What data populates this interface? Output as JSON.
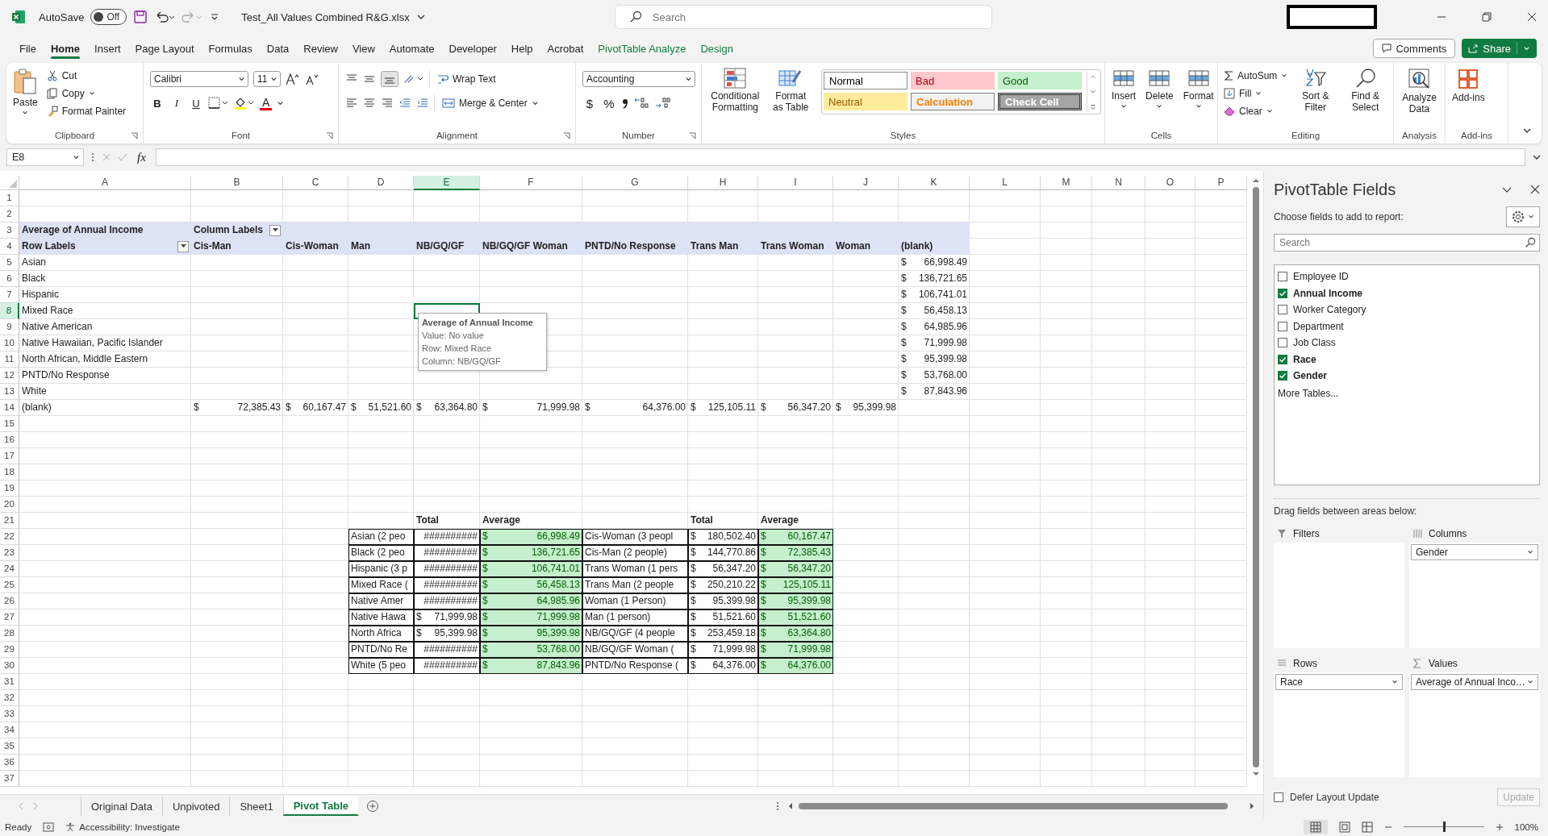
{
  "title_bar": {
    "autosave": {
      "label": "AutoSave",
      "on": false,
      "state": "Off"
    },
    "file_name": "Test_All Values Combined R&G.xlsx",
    "search": {
      "placeholder": "Search"
    }
  },
  "menu_tabs": [
    {
      "label": "File",
      "selected": false,
      "contextual": false
    },
    {
      "label": "Home",
      "selected": true,
      "contextual": false
    },
    {
      "label": "Insert",
      "selected": false,
      "contextual": false
    },
    {
      "label": "Page Layout",
      "selected": false,
      "contextual": false
    },
    {
      "label": "Formulas",
      "selected": false,
      "contextual": false
    },
    {
      "label": "Data",
      "selected": false,
      "contextual": false
    },
    {
      "label": "Review",
      "selected": false,
      "contextual": false
    },
    {
      "label": "View",
      "selected": false,
      "contextual": false
    },
    {
      "label": "Automate",
      "selected": false,
      "contextual": false
    },
    {
      "label": "Developer",
      "selected": false,
      "contextual": false
    },
    {
      "label": "Help",
      "selected": false,
      "contextual": false
    },
    {
      "label": "Acrobat",
      "selected": false,
      "contextual": false
    },
    {
      "label": "PivotTable Analyze",
      "selected": false,
      "contextual": true
    },
    {
      "label": "Design",
      "selected": false,
      "contextual": true
    }
  ],
  "account_buttons": {
    "comments": "Comments",
    "share": "Share"
  },
  "ribbon": {
    "clipboard": {
      "paste": "Paste",
      "cut": "Cut",
      "copy": "Copy",
      "format_painter": "Format Painter",
      "label": "Clipboard"
    },
    "font": {
      "name": "Calibri",
      "size": "11",
      "styles": [
        "B",
        "I",
        "U"
      ],
      "color_glyph": "A",
      "label": "Font"
    },
    "alignment": {
      "wrap": "Wrap Text",
      "merge": "Merge & Center",
      "label": "Alignment"
    },
    "number": {
      "format": "Accounting",
      "symbols": [
        "$",
        "%"
      ],
      "label": "Number"
    },
    "styles": {
      "conditional": "Conditional Formatting",
      "format_table": "Format as Table",
      "cells": [
        {
          "label": "Normal",
          "kind": "normal"
        },
        {
          "label": "Bad",
          "kind": "bad"
        },
        {
          "label": "Good",
          "kind": "good"
        },
        {
          "label": "Neutral",
          "kind": "neutral"
        },
        {
          "label": "Calculation",
          "kind": "calculation"
        },
        {
          "label": "Check Cell",
          "kind": "check"
        }
      ],
      "label": "Styles"
    },
    "cells": {
      "buttons": [
        "Insert",
        "Delete",
        "Format"
      ],
      "label": "Cells"
    },
    "editing": {
      "autosum": "AutoSum",
      "fill": "Fill",
      "clear": "Clear",
      "sort": "Sort & Filter",
      "find": "Find & Select",
      "label": "Editing"
    },
    "analysis": {
      "button": "Analyze Data",
      "label": "Analysis"
    },
    "addins": {
      "button": "Add-ins",
      "label": "Add-ins"
    }
  },
  "formula_bar": {
    "name_box": "E8",
    "fx": "fx"
  },
  "sheet": {
    "columns": [
      {
        "letter": "A",
        "selected": false
      },
      {
        "letter": "B",
        "selected": false
      },
      {
        "letter": "C",
        "selected": false
      },
      {
        "letter": "D",
        "selected": false
      },
      {
        "letter": "E",
        "selected": true
      },
      {
        "letter": "F",
        "selected": false
      },
      {
        "letter": "G",
        "selected": false
      },
      {
        "letter": "H",
        "selected": false
      },
      {
        "letter": "I",
        "selected": false
      },
      {
        "letter": "J",
        "selected": false
      },
      {
        "letter": "K",
        "selected": false
      },
      {
        "letter": "L",
        "selected": false
      },
      {
        "letter": "M",
        "selected": false
      },
      {
        "letter": "N",
        "selected": false
      },
      {
        "letter": "O",
        "selected": false
      },
      {
        "letter": "P",
        "selected": false
      }
    ],
    "rows": [
      {
        "number": "1",
        "selected": false,
        "kind": "plain"
      },
      {
        "number": "2",
        "selected": false,
        "kind": "plain"
      },
      {
        "number": "3",
        "selected": false,
        "kind": "pivot_header",
        "cells": [
          {
            "kind": "pivot_bold",
            "text": "Average of Annual Income"
          },
          {
            "kind": "pivot_filter",
            "text": "Column Labels"
          }
        ]
      },
      {
        "number": "4",
        "selected": false,
        "kind": "pivot_header",
        "cells": [
          {
            "kind": "pivot_filter",
            "text": "Row Labels"
          },
          {
            "kind": "pivot_bold",
            "text": "Cis-Man"
          },
          {
            "kind": "pivot_bold",
            "text": "Cis-Woman"
          },
          {
            "kind": "pivot_bold",
            "text": "Man"
          },
          {
            "kind": "pivot_bold",
            "text": "NB/GQ/GF"
          },
          {
            "kind": "pivot_bold",
            "text": "NB/GQ/GF Woman"
          },
          {
            "kind": "pivot_bold",
            "text": "PNTD/No Response"
          },
          {
            "kind": "pivot_bold",
            "text": "Trans Man"
          },
          {
            "kind": "pivot_bold",
            "text": "Trans Woman"
          },
          {
            "kind": "pivot_bold",
            "text": "Woman"
          },
          {
            "kind": "pivot_bold",
            "text": "(blank)"
          }
        ]
      },
      {
        "number": "5",
        "selected": false,
        "kind": "plain",
        "cells": [
          {
            "kind": "text",
            "text": "Asian"
          },
          {
            "kind": "empty"
          },
          {
            "kind": "empty"
          },
          {
            "kind": "empty"
          },
          {
            "kind": "empty"
          },
          {
            "kind": "empty"
          },
          {
            "kind": "empty"
          },
          {
            "kind": "empty"
          },
          {
            "kind": "empty"
          },
          {
            "kind": "empty"
          },
          {
            "kind": "money",
            "currency": "$",
            "amount": "66,998.49"
          }
        ]
      },
      {
        "number": "6",
        "selected": false,
        "kind": "plain",
        "cells": [
          {
            "kind": "text",
            "text": "Black"
          },
          {
            "kind": "empty"
          },
          {
            "kind": "empty"
          },
          {
            "kind": "empty"
          },
          {
            "kind": "empty"
          },
          {
            "kind": "empty"
          },
          {
            "kind": "empty"
          },
          {
            "kind": "empty"
          },
          {
            "kind": "empty"
          },
          {
            "kind": "empty"
          },
          {
            "kind": "money",
            "currency": "$",
            "amount": "136,721.65"
          }
        ]
      },
      {
        "number": "7",
        "selected": false,
        "kind": "plain",
        "cells": [
          {
            "kind": "text",
            "text": "Hispanic"
          },
          {
            "kind": "empty"
          },
          {
            "kind": "empty"
          },
          {
            "kind": "empty"
          },
          {
            "kind": "empty"
          },
          {
            "kind": "empty"
          },
          {
            "kind": "empty"
          },
          {
            "kind": "empty"
          },
          {
            "kind": "empty"
          },
          {
            "kind": "empty"
          },
          {
            "kind": "money",
            "currency": "$",
            "amount": "106,741.01"
          }
        ]
      },
      {
        "number": "8",
        "selected": true,
        "kind": "plain",
        "cells": [
          {
            "kind": "text",
            "text": "Mixed Race"
          },
          {
            "kind": "empty"
          },
          {
            "kind": "empty"
          },
          {
            "kind": "empty"
          },
          {
            "kind": "empty"
          },
          {
            "kind": "empty"
          },
          {
            "kind": "empty"
          },
          {
            "kind": "empty"
          },
          {
            "kind": "empty"
          },
          {
            "kind": "empty"
          },
          {
            "kind": "money",
            "currency": "$",
            "amount": "56,458.13"
          }
        ]
      },
      {
        "number": "9",
        "selected": false,
        "kind": "plain",
        "cells": [
          {
            "kind": "text",
            "text": "Native American"
          },
          {
            "kind": "empty"
          },
          {
            "kind": "empty"
          },
          {
            "kind": "empty"
          },
          {
            "kind": "empty"
          },
          {
            "kind": "empty"
          },
          {
            "kind": "empty"
          },
          {
            "kind": "empty"
          },
          {
            "kind": "empty"
          },
          {
            "kind": "empty"
          },
          {
            "kind": "money",
            "currency": "$",
            "amount": "64,985.96"
          }
        ]
      },
      {
        "number": "10",
        "selected": false,
        "kind": "plain",
        "cells": [
          {
            "kind": "text",
            "text": "Native Hawaiian, Pacific Islander"
          },
          {
            "kind": "empty"
          },
          {
            "kind": "empty"
          },
          {
            "kind": "empty"
          },
          {
            "kind": "empty"
          },
          {
            "kind": "empty"
          },
          {
            "kind": "empty"
          },
          {
            "kind": "empty"
          },
          {
            "kind": "empty"
          },
          {
            "kind": "empty"
          },
          {
            "kind": "money",
            "currency": "$",
            "amount": "71,999.98"
          }
        ]
      },
      {
        "number": "11",
        "selected": false,
        "kind": "plain",
        "cells": [
          {
            "kind": "text",
            "text": "North African, Middle Eastern"
          },
          {
            "kind": "empty"
          },
          {
            "kind": "empty"
          },
          {
            "kind": "empty"
          },
          {
            "kind": "empty"
          },
          {
            "kind": "empty"
          },
          {
            "kind": "empty"
          },
          {
            "kind": "empty"
          },
          {
            "kind": "empty"
          },
          {
            "kind": "empty"
          },
          {
            "kind": "money",
            "currency": "$",
            "amount": "95,399.98"
          }
        ]
      },
      {
        "number": "12",
        "selected": false,
        "kind": "plain",
        "cells": [
          {
            "kind": "text",
            "text": "PNTD/No Response"
          },
          {
            "kind": "empty"
          },
          {
            "kind": "empty"
          },
          {
            "kind": "empty"
          },
          {
            "kind": "empty"
          },
          {
            "kind": "empty"
          },
          {
            "kind": "empty"
          },
          {
            "kind": "empty"
          },
          {
            "kind": "empty"
          },
          {
            "kind": "empty"
          },
          {
            "kind": "money",
            "currency": "$",
            "amount": "53,768.00"
          }
        ]
      },
      {
        "number": "13",
        "selected": false,
        "kind": "plain",
        "cells": [
          {
            "kind": "text",
            "text": "White"
          },
          {
            "kind": "empty"
          },
          {
            "kind": "empty"
          },
          {
            "kind": "empty"
          },
          {
            "kind": "empty"
          },
          {
            "kind": "empty"
          },
          {
            "kind": "empty"
          },
          {
            "kind": "empty"
          },
          {
            "kind": "empty"
          },
          {
            "kind": "empty"
          },
          {
            "kind": "money",
            "currency": "$",
            "amount": "87,843.96"
          }
        ]
      },
      {
        "number": "14",
        "selected": false,
        "kind": "plain",
        "cells": [
          {
            "kind": "text",
            "text": "(blank)"
          },
          {
            "kind": "money",
            "currency": "$",
            "amount": "72,385.43"
          },
          {
            "kind": "money",
            "currency": "$",
            "amount": "60,167.47"
          },
          {
            "kind": "money",
            "currency": "$",
            "amount": "51,521.60"
          },
          {
            "kind": "money",
            "currency": "$",
            "amount": "63,364.80"
          },
          {
            "kind": "money",
            "currency": "$",
            "amount": "71,999.98"
          },
          {
            "kind": "money",
            "currency": "$",
            "amount": "64,376.00"
          },
          {
            "kind": "money",
            "currency": "$",
            "amount": "125,105.11"
          },
          {
            "kind": "money",
            "currency": "$",
            "amount": "56,347.20"
          },
          {
            "kind": "money",
            "currency": "$",
            "amount": "95,399.98"
          }
        ]
      },
      {
        "number": "15",
        "selected": false,
        "kind": "plain"
      },
      {
        "number": "16",
        "selected": false,
        "kind": "plain"
      },
      {
        "number": "17",
        "selected": false,
        "kind": "plain"
      },
      {
        "number": "18",
        "selected": false,
        "kind": "plain"
      },
      {
        "number": "19",
        "selected": false,
        "kind": "plain"
      },
      {
        "number": "20",
        "selected": false,
        "kind": "plain"
      },
      {
        "number": "21",
        "selected": false,
        "kind": "plain",
        "cells": [
          {
            "kind": "empty"
          },
          {
            "kind": "empty"
          },
          {
            "kind": "empty"
          },
          {
            "kind": "empty"
          },
          {
            "kind": "bold",
            "text": "Total"
          },
          {
            "kind": "bold",
            "text": "Average"
          },
          {
            "kind": "empty"
          },
          {
            "kind": "bold",
            "text": "Total"
          },
          {
            "kind": "bold",
            "text": "Average"
          }
        ]
      },
      {
        "number": "22",
        "selected": false,
        "kind": "plain",
        "cells": [
          {
            "kind": "empty"
          },
          {
            "kind": "empty"
          },
          {
            "kind": "empty"
          },
          {
            "kind": "boxed_text",
            "text": "Asian (2 peo"
          },
          {
            "kind": "boxed_hash",
            "text": "##########"
          },
          {
            "kind": "good_money",
            "currency": "$",
            "amount": "66,998.49"
          },
          {
            "kind": "boxed_text",
            "text": "Cis-Woman (3 peopl"
          },
          {
            "kind": "boxed_money",
            "currency": "$",
            "amount": "180,502.40"
          },
          {
            "kind": "good_money",
            "currency": "$",
            "amount": "60,167.47"
          }
        ]
      },
      {
        "number": "23",
        "selected": false,
        "kind": "plain",
        "cells": [
          {
            "kind": "empty"
          },
          {
            "kind": "empty"
          },
          {
            "kind": "empty"
          },
          {
            "kind": "boxed_text",
            "text": "Black (2 peo"
          },
          {
            "kind": "boxed_hash",
            "text": "##########"
          },
          {
            "kind": "good_money",
            "currency": "$",
            "amount": "136,721.65"
          },
          {
            "kind": "boxed_text",
            "text": "Cis-Man (2 people)"
          },
          {
            "kind": "boxed_money",
            "currency": "$",
            "amount": "144,770.86"
          },
          {
            "kind": "good_money",
            "currency": "$",
            "amount": "72,385.43"
          }
        ]
      },
      {
        "number": "24",
        "selected": false,
        "kind": "plain",
        "cells": [
          {
            "kind": "empty"
          },
          {
            "kind": "empty"
          },
          {
            "kind": "empty"
          },
          {
            "kind": "boxed_text",
            "text": "Hispanic (3 p"
          },
          {
            "kind": "boxed_hash",
            "text": "##########"
          },
          {
            "kind": "good_money",
            "currency": "$",
            "amount": "106,741.01"
          },
          {
            "kind": "boxed_text",
            "text": "Trans Woman (1 pers"
          },
          {
            "kind": "boxed_money",
            "currency": "$",
            "amount": "56,347.20"
          },
          {
            "kind": "good_money",
            "currency": "$",
            "amount": "56,347.20"
          }
        ]
      },
      {
        "number": "25",
        "selected": false,
        "kind": "plain",
        "cells": [
          {
            "kind": "empty"
          },
          {
            "kind": "empty"
          },
          {
            "kind": "empty"
          },
          {
            "kind": "boxed_text",
            "text": "Mixed Race ("
          },
          {
            "kind": "boxed_hash",
            "text": "##########"
          },
          {
            "kind": "good_money",
            "currency": "$",
            "amount": "56,458.13"
          },
          {
            "kind": "boxed_text",
            "text": "Trans Man (2 people"
          },
          {
            "kind": "boxed_money",
            "currency": "$",
            "amount": "250,210.22"
          },
          {
            "kind": "good_money",
            "currency": "$",
            "amount": "125,105.11"
          }
        ]
      },
      {
        "number": "26",
        "selected": false,
        "kind": "plain",
        "cells": [
          {
            "kind": "empty"
          },
          {
            "kind": "empty"
          },
          {
            "kind": "empty"
          },
          {
            "kind": "boxed_text",
            "text": "Native Amer"
          },
          {
            "kind": "boxed_hash",
            "text": "##########"
          },
          {
            "kind": "good_money",
            "currency": "$",
            "amount": "64,985.96"
          },
          {
            "kind": "boxed_text",
            "text": "Woman (1 Person)"
          },
          {
            "kind": "boxed_money",
            "currency": "$",
            "amount": "95,399.98"
          },
          {
            "kind": "good_money",
            "currency": "$",
            "amount": "95,399.98"
          }
        ]
      },
      {
        "number": "27",
        "selected": false,
        "kind": "plain",
        "cells": [
          {
            "kind": "empty"
          },
          {
            "kind": "empty"
          },
          {
            "kind": "empty"
          },
          {
            "kind": "boxed_text",
            "text": "Native Hawa"
          },
          {
            "kind": "boxed_money",
            "currency": "$",
            "amount": "71,999.98"
          },
          {
            "kind": "good_money",
            "currency": "$",
            "amount": "71,999.98"
          },
          {
            "kind": "boxed_text",
            "text": "Man (1 person)"
          },
          {
            "kind": "boxed_money",
            "currency": "$",
            "amount": "51,521.60"
          },
          {
            "kind": "good_money",
            "currency": "$",
            "amount": "51,521.60"
          }
        ]
      },
      {
        "number": "28",
        "selected": false,
        "kind": "plain",
        "cells": [
          {
            "kind": "empty"
          },
          {
            "kind": "empty"
          },
          {
            "kind": "empty"
          },
          {
            "kind": "boxed_text",
            "text": "North Africa"
          },
          {
            "kind": "boxed_money",
            "currency": "$",
            "amount": "95,399.98"
          },
          {
            "kind": "good_money",
            "currency": "$",
            "amount": "95,399.98"
          },
          {
            "kind": "boxed_text",
            "text": "NB/GQ/GF (4 people"
          },
          {
            "kind": "boxed_money",
            "currency": "$",
            "amount": "253,459.18"
          },
          {
            "kind": "good_money",
            "currency": "$",
            "amount": "63,364.80"
          }
        ]
      },
      {
        "number": "29",
        "selected": false,
        "kind": "plain",
        "cells": [
          {
            "kind": "empty"
          },
          {
            "kind": "empty"
          },
          {
            "kind": "empty"
          },
          {
            "kind": "boxed_text",
            "text": "PNTD/No Re"
          },
          {
            "kind": "boxed_hash",
            "text": "##########"
          },
          {
            "kind": "good_money",
            "currency": "$",
            "amount": "53,768.00"
          },
          {
            "kind": "boxed_text",
            "text": "NB/GQ/GF Woman ("
          },
          {
            "kind": "boxed_money",
            "currency": "$",
            "amount": "71,999.98"
          },
          {
            "kind": "good_money",
            "currency": "$",
            "amount": "71,999.98"
          }
        ]
      },
      {
        "number": "30",
        "selected": false,
        "kind": "plain",
        "cells": [
          {
            "kind": "empty"
          },
          {
            "kind": "empty"
          },
          {
            "kind": "empty"
          },
          {
            "kind": "boxed_text",
            "text": "White (5 peo"
          },
          {
            "kind": "boxed_hash",
            "text": "##########"
          },
          {
            "kind": "good_money",
            "currency": "$",
            "amount": "87,843.96"
          },
          {
            "kind": "boxed_text",
            "text": "PNTD/No Response ("
          },
          {
            "kind": "boxed_money",
            "currency": "$",
            "amount": "64,376.00"
          },
          {
            "kind": "good_money",
            "currency": "$",
            "amount": "64,376.00"
          }
        ]
      },
      {
        "number": "31",
        "selected": false,
        "kind": "plain"
      },
      {
        "number": "32",
        "selected": false,
        "kind": "plain"
      },
      {
        "number": "33",
        "selected": false,
        "kind": "plain"
      },
      {
        "number": "34",
        "selected": false,
        "kind": "plain"
      },
      {
        "number": "35",
        "selected": false,
        "kind": "plain"
      },
      {
        "number": "36",
        "selected": false,
        "kind": "plain"
      },
      {
        "number": "37",
        "selected": false,
        "kind": "plain"
      }
    ],
    "tooltip": {
      "title": "Average of Annual Income",
      "lines": [
        "Value: No value",
        "Row: Mixed Race",
        "Column: NB/GQ/GF"
      ]
    }
  },
  "sheet_tabs": [
    {
      "label": "Original Data",
      "selected": false
    },
    {
      "label": "Unpivoted",
      "selected": false
    },
    {
      "label": "Sheet1",
      "selected": false
    },
    {
      "label": "Pivot Table",
      "selected": true
    }
  ],
  "status_bar": {
    "ready": "Ready",
    "accessibility": "Accessibility: Investigate",
    "zoom": {
      "level": 0.5,
      "label": "100%"
    }
  },
  "pivot_fields": {
    "title": "PivotTable Fields",
    "choose_label": "Choose fields to add to report:",
    "search": {
      "placeholder": "Search"
    },
    "fields": [
      {
        "label": "Employee ID",
        "checked": false
      },
      {
        "label": "Annual Income",
        "checked": true
      },
      {
        "label": "Worker Category",
        "checked": false
      },
      {
        "label": "Department",
        "checked": false
      },
      {
        "label": "Job Class",
        "checked": false
      },
      {
        "label": "Race",
        "checked": true
      },
      {
        "label": "Gender",
        "checked": true
      }
    ],
    "more_tables": "More Tables...",
    "drag_label": "Drag fields between areas below:",
    "areas": [
      {
        "kind": "filters",
        "label": "Filters"
      },
      {
        "kind": "columns",
        "label": "Columns",
        "fields": [
          "Gender"
        ]
      },
      {
        "kind": "rows",
        "label": "Rows",
        "fields": [
          "Race"
        ]
      },
      {
        "kind": "values",
        "label": "Values",
        "fields": [
          "Average of Annual Inco…"
        ]
      }
    ],
    "defer": {
      "label": "Defer Layout Update",
      "checked": false
    },
    "update": {
      "label": "Update",
      "disabled": true
    }
  }
}
